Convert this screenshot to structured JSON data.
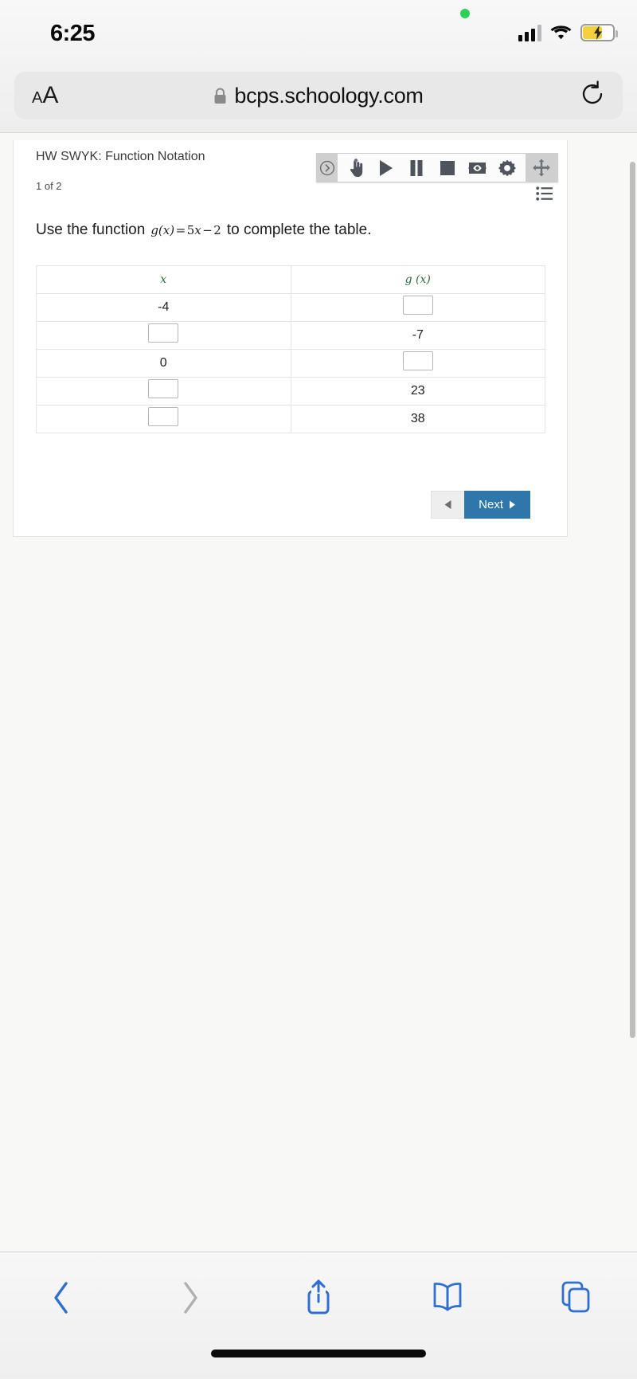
{
  "status_bar": {
    "time": "6:25",
    "icons": {
      "recording_dot": "green-recording-dot",
      "cellular": "signal-bars-icon",
      "wifi": "wifi-icon",
      "battery": "battery-charging-icon"
    }
  },
  "browser": {
    "text_size_small": "A",
    "text_size_large": "A",
    "lock_icon": "lock-icon",
    "url": "bcps.schoology.com",
    "reload_icon": "reload-icon"
  },
  "assignment": {
    "title": "HW SWYK: Function Notation",
    "page_count": "1 of 2"
  },
  "ax_toolbar": {
    "handle_left": "collapse-chevron-icon",
    "buttons": [
      {
        "name": "pointer-hand-icon",
        "label": "pointer"
      },
      {
        "name": "play-icon",
        "label": "play"
      },
      {
        "name": "pause-icon",
        "label": "pause"
      },
      {
        "name": "stop-icon",
        "label": "stop"
      },
      {
        "name": "screen-reader-icon",
        "label": "screen reader"
      },
      {
        "name": "settings-gear-icon",
        "label": "settings"
      }
    ],
    "handle_right": "move-arrows-icon",
    "list_button": "list-view-icon"
  },
  "question": {
    "prefix": "Use the function",
    "formula": "g (x) = 5x − 2",
    "formula_parts": {
      "fn": "g",
      "open": "(",
      "var": "x",
      "close": ")",
      "eq": "=",
      "coef": "5",
      "var2": "x",
      "minus": "−",
      "const": "2"
    },
    "suffix": "to complete the table."
  },
  "table": {
    "headers": [
      "x",
      "g (x)"
    ],
    "header_color": "#2f6b3a",
    "rows": [
      {
        "x": "-4",
        "gx": "",
        "x_input": false,
        "gx_input": true
      },
      {
        "x": "",
        "gx": "-7",
        "x_input": true,
        "gx_input": false
      },
      {
        "x": "0",
        "gx": "",
        "x_input": false,
        "gx_input": true
      },
      {
        "x": "",
        "gx": "23",
        "x_input": true,
        "gx_input": false
      },
      {
        "x": "",
        "gx": "38",
        "x_input": true,
        "gx_input": false
      }
    ]
  },
  "navigation": {
    "prev_label": "",
    "prev_icon": "triangle-left-icon",
    "next_label": "Next",
    "next_icon": "triangle-right-icon",
    "next_color": "#2e77ab"
  },
  "bottom_bar": {
    "buttons": [
      {
        "name": "back-icon",
        "enabled": true
      },
      {
        "name": "forward-icon",
        "enabled": false
      },
      {
        "name": "share-icon",
        "enabled": true
      },
      {
        "name": "bookmarks-icon",
        "enabled": true
      },
      {
        "name": "tabs-icon",
        "enabled": true
      }
    ],
    "accent_color": "#2f6fd0",
    "disabled_color": "#b0b0b0"
  }
}
